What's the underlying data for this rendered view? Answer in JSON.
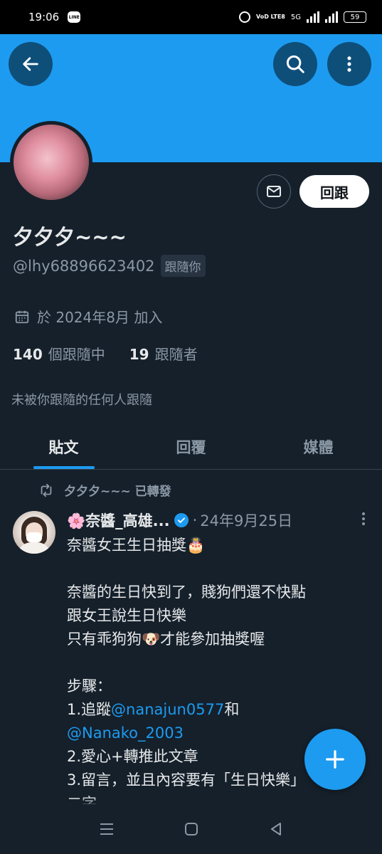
{
  "status_bar": {
    "time": "19:06",
    "line_badge": "LINE",
    "network_label": "VoD LTE8",
    "network_type": "5G",
    "battery": "59"
  },
  "header": {
    "banner_color": "#1d9bf0",
    "back_icon": "arrow-left-icon",
    "search_icon": "search-icon",
    "more_icon": "more-vertical-icon"
  },
  "profile": {
    "display_name": "夕夕夕~~~",
    "handle": "@lhy68896623402",
    "follows_you_badge": "跟隨你",
    "follow_back_label": "回跟",
    "joined": "於 2024年8月 加入",
    "following_count": "140",
    "following_label": "個跟隨中",
    "followers_count": "19",
    "followers_label": "跟隨者",
    "not_followed_text": "未被你跟隨的任何人跟隨"
  },
  "tabs": [
    {
      "label": "貼文",
      "active": true
    },
    {
      "label": "回覆",
      "active": false
    },
    {
      "label": "媒體",
      "active": false
    }
  ],
  "tweet": {
    "retweet_label": "夕夕夕~~~ 已轉發",
    "author": "🌸奈醬_高雄...",
    "dot": "·",
    "date": "24年9月25日",
    "lines": [
      "奈醬女王生日抽獎🎂",
      "",
      "奈醬的生日快到了，賤狗們還不快點",
      "跟女王說生日快樂",
      "只有乖狗狗🐶才能參加抽獎喔",
      "",
      "步驟：",
      "1.追蹤",
      "2.愛心+轉推此文章",
      "3.留言，並且內容要有「生日快樂」",
      "二字"
    ],
    "mention_1": "@nanajun0577",
    "mention_joiner": "和",
    "mention_2": "@Nanako_2003"
  },
  "accent_color": "#1d9bf0"
}
